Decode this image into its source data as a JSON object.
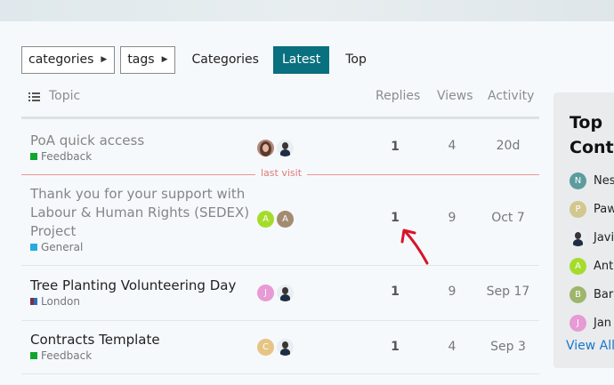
{
  "nav": {
    "categories_dropdown": "categories",
    "tags_dropdown": "tags",
    "links": [
      "Categories",
      "Latest",
      "Top"
    ],
    "active": "Latest",
    "active_color": "#08707e"
  },
  "table_header": {
    "topic": "Topic",
    "replies": "Replies",
    "views": "Views",
    "activity": "Activity"
  },
  "last_visit_label": "last visit",
  "topics": [
    {
      "title": "PoA quick access",
      "category": "Feedback",
      "category_color": "#12a52e",
      "visited": true,
      "avatars": [
        {
          "type": "photo-w",
          "letter": ""
        },
        {
          "type": "photo-m",
          "letter": ""
        }
      ],
      "replies": "1",
      "views": "4",
      "activity": "20d"
    },
    {
      "title": "Thank you for your support with Labour & Human Rights (SEDEX) Project",
      "category": "General",
      "category_color": "#2aa9e0",
      "visited": true,
      "avatars": [
        {
          "type": "letter",
          "letter": "A",
          "color": "#a5dc2c"
        },
        {
          "type": "letter",
          "letter": "A",
          "color": "#a38b6f"
        }
      ],
      "replies": "1",
      "views": "9",
      "activity": "Oct 7"
    },
    {
      "title": "Tree Planting Volunteering Day",
      "category": "London",
      "category_color": "#7b2f48",
      "visited": false,
      "avatars": [
        {
          "type": "letter",
          "letter": "J",
          "color": "#e79ad4"
        },
        {
          "type": "photo-m",
          "letter": ""
        }
      ],
      "replies": "1",
      "views": "9",
      "activity": "Sep 17"
    },
    {
      "title": "Contracts Template",
      "category": "Feedback",
      "category_color": "#12a52e",
      "visited": false,
      "avatars": [
        {
          "type": "letter",
          "letter": "C",
          "color": "#e6c483"
        },
        {
          "type": "photo-m",
          "letter": ""
        }
      ],
      "replies": "1",
      "views": "4",
      "activity": "Sep 3"
    }
  ],
  "sidebar": {
    "title_line1": "Top",
    "title_line2": "Cont",
    "contributors": [
      {
        "name": "Nes",
        "letter": "N",
        "color": "#5c9c9c",
        "type": "letter"
      },
      {
        "name": "Paw",
        "letter": "P",
        "color": "#d2c78f",
        "type": "letter"
      },
      {
        "name": "Javi",
        "letter": "",
        "color": "",
        "type": "photo-m"
      },
      {
        "name": "Ant",
        "letter": "A",
        "color": "#a5dc2c",
        "type": "letter"
      },
      {
        "name": "Bar",
        "letter": "B",
        "color": "#9eb56a",
        "type": "letter"
      },
      {
        "name": "Jan",
        "letter": "J",
        "color": "#e79ad4",
        "type": "letter"
      }
    ],
    "view_all": "View All"
  },
  "annotation": {
    "color": "#d7142a"
  }
}
